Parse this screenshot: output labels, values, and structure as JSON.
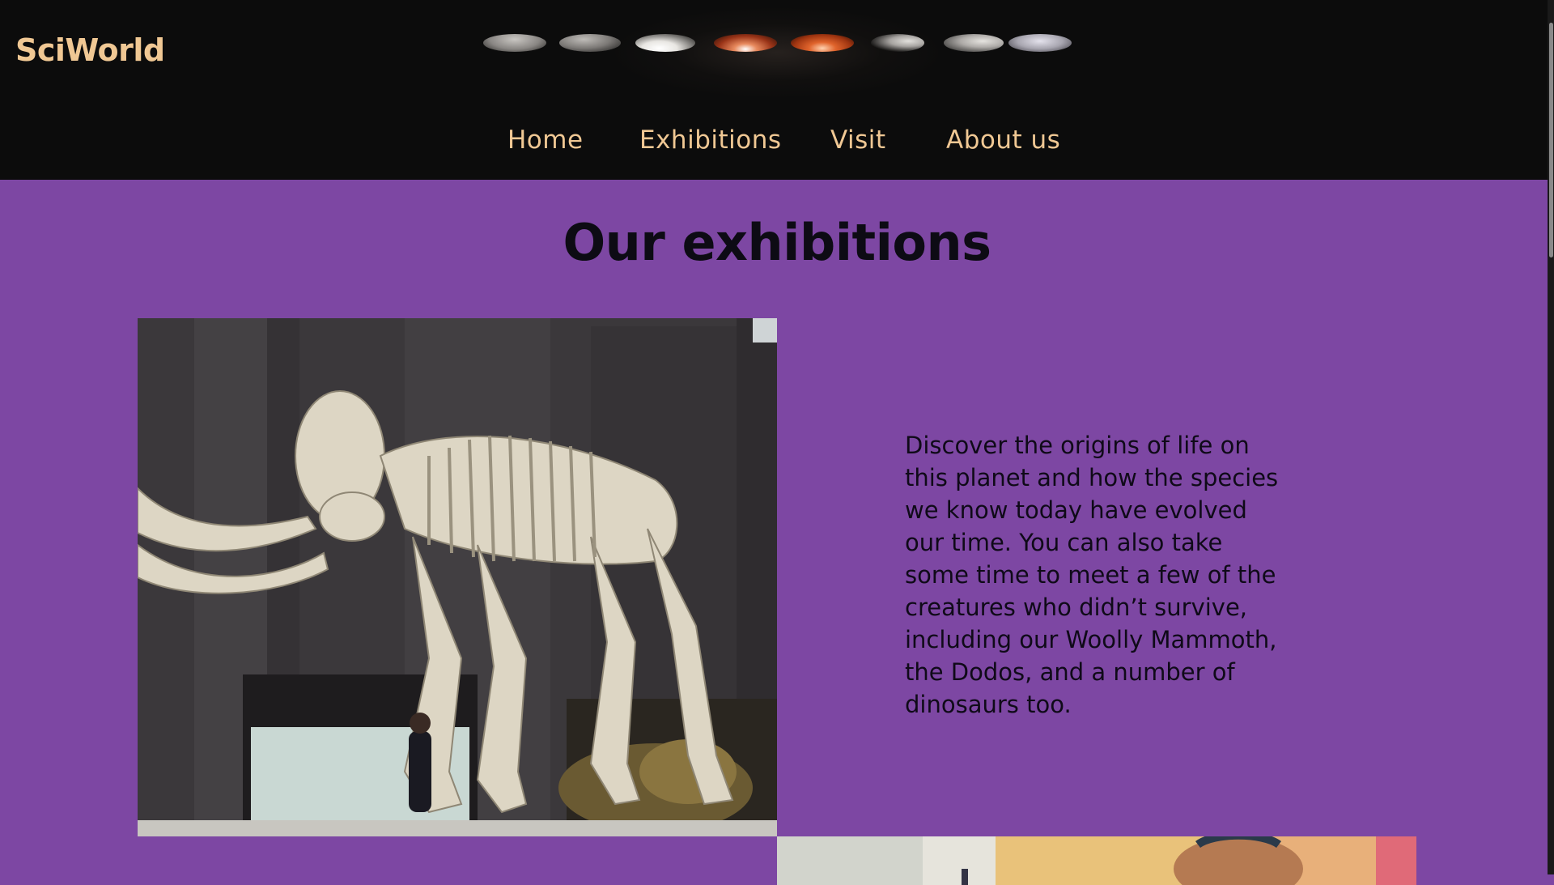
{
  "header": {
    "brand": "SciWorld",
    "moon_icons": [
      "moon-phase-icon",
      "lunar-eclipse-icon"
    ]
  },
  "nav": {
    "items": [
      {
        "label": "Home"
      },
      {
        "label": "Exhibitions"
      },
      {
        "label": "Visit"
      },
      {
        "label": "About us"
      }
    ]
  },
  "main": {
    "title": "Our exhibitions",
    "exhibit": {
      "image": "woolly-mammoth-skeleton-photo",
      "description": "Discover the origins of life on this planet and how the species we know today have evolved our time. You can also take some time to meet a few of the creatures who didn’t survive, including our Woolly Mammoth, the Dodos, and a number of dinosaurs too."
    },
    "next_image": "visitor-with-headphones-photo"
  },
  "colors": {
    "header_bg": "#0c0c0c",
    "accent": "#f0c894",
    "page_bg": "#7d47a3",
    "text": "#0d0b14"
  }
}
